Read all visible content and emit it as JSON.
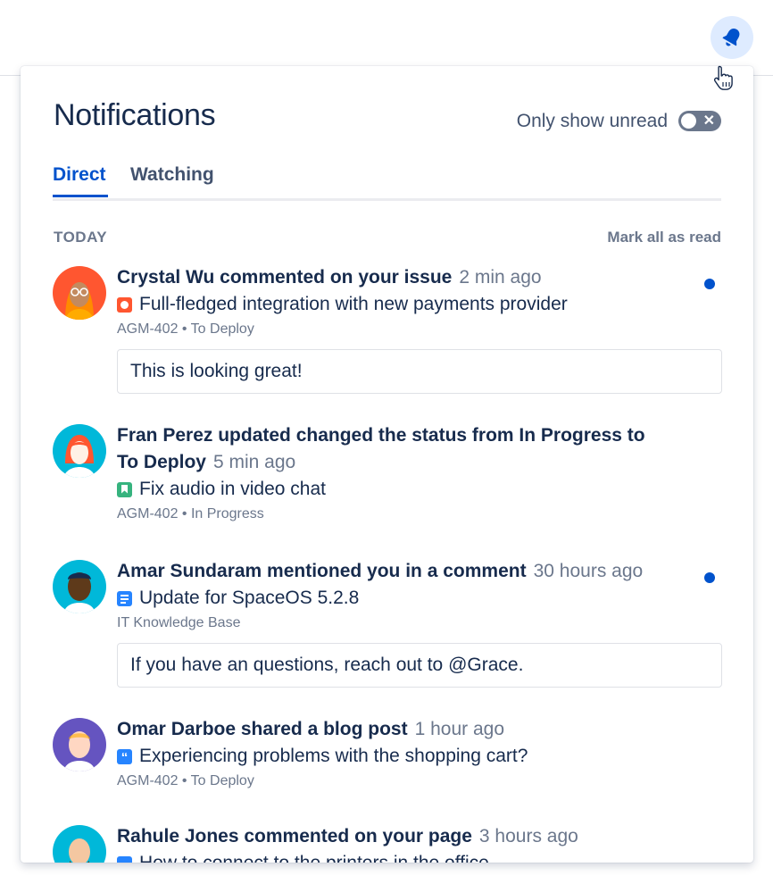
{
  "panel": {
    "title": "Notifications",
    "toggle_label": "Only show unread",
    "toggle_on": false
  },
  "tabs": [
    {
      "label": "Direct",
      "active": true
    },
    {
      "label": "Watching",
      "active": false
    }
  ],
  "section": {
    "label": "TODAY",
    "mark_all": "Mark all as read"
  },
  "notifications": [
    {
      "actor": "Crystal Wu commented on your issue",
      "actor_line2": "",
      "time": "2 min ago",
      "issue_icon": "bug-icon",
      "issue_icon_color": "#ff5630",
      "issue": "Full-fledged integration with new payments provider",
      "meta": "AGM-402 • To Deploy",
      "comment": "This is looking great!",
      "unread": true
    },
    {
      "actor": "Fran Perez updated changed the status from In Progress to",
      "actor_line2": "To Deploy",
      "time": "5 min ago",
      "issue_icon": "story-icon",
      "issue_icon_color": "#36b37e",
      "issue": "Fix audio in video chat",
      "meta": "AGM-402 • In Progress",
      "comment": "",
      "unread": false
    },
    {
      "actor": "Amar Sundaram mentioned you in a comment",
      "actor_line2": "",
      "time": "30 hours ago",
      "issue_icon": "page-icon",
      "issue_icon_color": "#2684ff",
      "issue": "Update for SpaceOS 5.2.8",
      "meta": "IT Knowledge Base",
      "comment": "If you have an questions, reach out to @Grace.",
      "unread": true
    },
    {
      "actor": "Omar Darboe shared a blog post",
      "actor_line2": "",
      "time": "1 hour ago",
      "issue_icon": "quote-icon",
      "issue_icon_color": "#2684ff",
      "issue": "Experiencing problems with the shopping cart?",
      "meta": "AGM-402 • To Deploy",
      "comment": "",
      "unread": false
    },
    {
      "actor": "Rahule Jones commented on your page",
      "actor_line2": "",
      "time": "3 hours ago",
      "issue_icon": "page-icon",
      "issue_icon_color": "#2684ff",
      "issue": "How to connect to the printers in the office",
      "meta": "",
      "comment": "",
      "unread": false
    }
  ],
  "colors": {
    "accent": "#0052cc",
    "unread_dot": "#0052cc",
    "bell_bg": "#deebff"
  }
}
